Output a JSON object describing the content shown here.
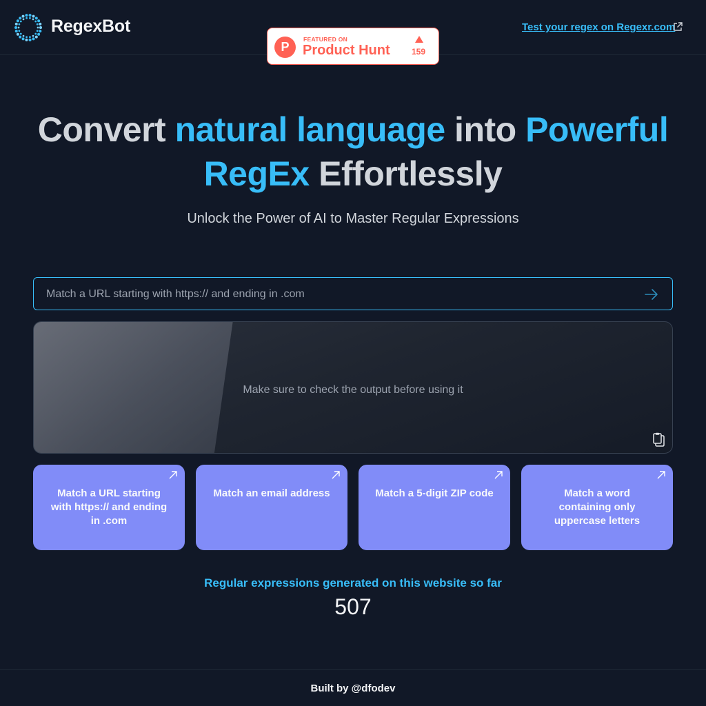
{
  "header": {
    "brand": "RegexBot",
    "logo_icon": "dotted-ring-logo",
    "product_hunt": {
      "small_label": "FEATURED ON",
      "name": "Product Hunt",
      "logo_letter": "P",
      "upvotes": "159",
      "color": "#ff6154"
    },
    "external_link": "Test your regex on Regexr.com",
    "external_icon": "external-link-icon"
  },
  "hero": {
    "part1": "Convert ",
    "accent1": "natural language",
    "part2": " into ",
    "accent2": "Powerful",
    "accent3": "RegEx",
    "part3": " Effortlessly",
    "accent_color": "#38bdf8"
  },
  "subtitle": "Unlock the Power of AI to Master Regular Expressions",
  "prompt": {
    "placeholder": "Match a URL starting with https:// and ending in .com",
    "value": "",
    "send_icon": "arrow-right-icon"
  },
  "output": {
    "text": "Make sure to check the output before using it",
    "copy_icon": "clipboard-icon"
  },
  "examples": [
    {
      "label": "Match a URL starting with https:// and ending in .com"
    },
    {
      "label": "Match an email address"
    },
    {
      "label": "Match a 5-digit ZIP code"
    },
    {
      "label": "Match a word containing only uppercase letters"
    }
  ],
  "stats": {
    "label": "Regular expressions generated on this website so far",
    "count": "507"
  },
  "footer": {
    "text": "Built by @dfodev"
  }
}
